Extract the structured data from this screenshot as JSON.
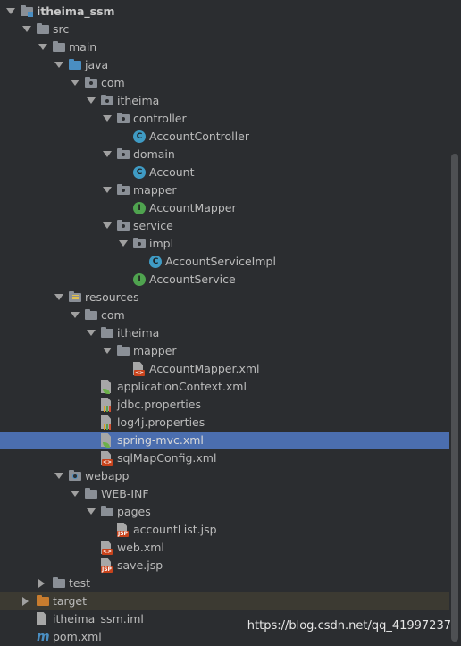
{
  "tree": [
    {
      "label": "itheima_ssm",
      "kind": "module",
      "expanded": true,
      "bold": true
    },
    {
      "label": "src",
      "kind": "folder",
      "expanded": true
    },
    {
      "label": "main",
      "kind": "folder",
      "expanded": true
    },
    {
      "label": "java",
      "kind": "source-folder",
      "expanded": true
    },
    {
      "label": "com",
      "kind": "package",
      "expanded": true
    },
    {
      "label": "itheima",
      "kind": "package",
      "expanded": true
    },
    {
      "label": "controller",
      "kind": "package",
      "expanded": true
    },
    {
      "label": "AccountController",
      "kind": "class"
    },
    {
      "label": "domain",
      "kind": "package",
      "expanded": true
    },
    {
      "label": "Account",
      "kind": "class"
    },
    {
      "label": "mapper",
      "kind": "package",
      "expanded": true
    },
    {
      "label": "AccountMapper",
      "kind": "interface"
    },
    {
      "label": "service",
      "kind": "package",
      "expanded": true
    },
    {
      "label": "impl",
      "kind": "package",
      "expanded": true
    },
    {
      "label": "AccountServiceImpl",
      "kind": "class"
    },
    {
      "label": "AccountService",
      "kind": "interface"
    },
    {
      "label": "resources",
      "kind": "resources-folder",
      "expanded": true
    },
    {
      "label": "com",
      "kind": "folder",
      "expanded": true
    },
    {
      "label": "itheima",
      "kind": "folder",
      "expanded": true
    },
    {
      "label": "mapper",
      "kind": "folder",
      "expanded": true
    },
    {
      "label": "AccountMapper.xml",
      "kind": "xml-file"
    },
    {
      "label": "applicationContext.xml",
      "kind": "spring-xml-file"
    },
    {
      "label": "jdbc.properties",
      "kind": "properties-file"
    },
    {
      "label": "log4j.properties",
      "kind": "properties-file"
    },
    {
      "label": "spring-mvc.xml",
      "kind": "spring-xml-file",
      "selected": true
    },
    {
      "label": "sqlMapConfig.xml",
      "kind": "xml-file"
    },
    {
      "label": "webapp",
      "kind": "web-folder",
      "expanded": true
    },
    {
      "label": "WEB-INF",
      "kind": "folder",
      "expanded": true
    },
    {
      "label": "pages",
      "kind": "folder",
      "expanded": true
    },
    {
      "label": "accountList.jsp",
      "kind": "jsp-file"
    },
    {
      "label": "web.xml",
      "kind": "web-xml-file"
    },
    {
      "label": "save.jsp",
      "kind": "jsp-file"
    },
    {
      "label": "test",
      "kind": "folder",
      "expanded": false
    },
    {
      "label": "target",
      "kind": "excluded-folder",
      "expanded": false,
      "dim": true
    },
    {
      "label": "itheima_ssm.iml",
      "kind": "iml-file"
    },
    {
      "label": "pom.xml",
      "kind": "maven-file"
    }
  ],
  "watermark": "https://blog.csdn.net/qq_41997237",
  "colors": {
    "background": "#2b2d30",
    "selection": "#4b6eaf",
    "class_icon": "#3f9bc4",
    "interface_icon": "#4fa34f",
    "excluded_folder": "#c87c2e"
  }
}
